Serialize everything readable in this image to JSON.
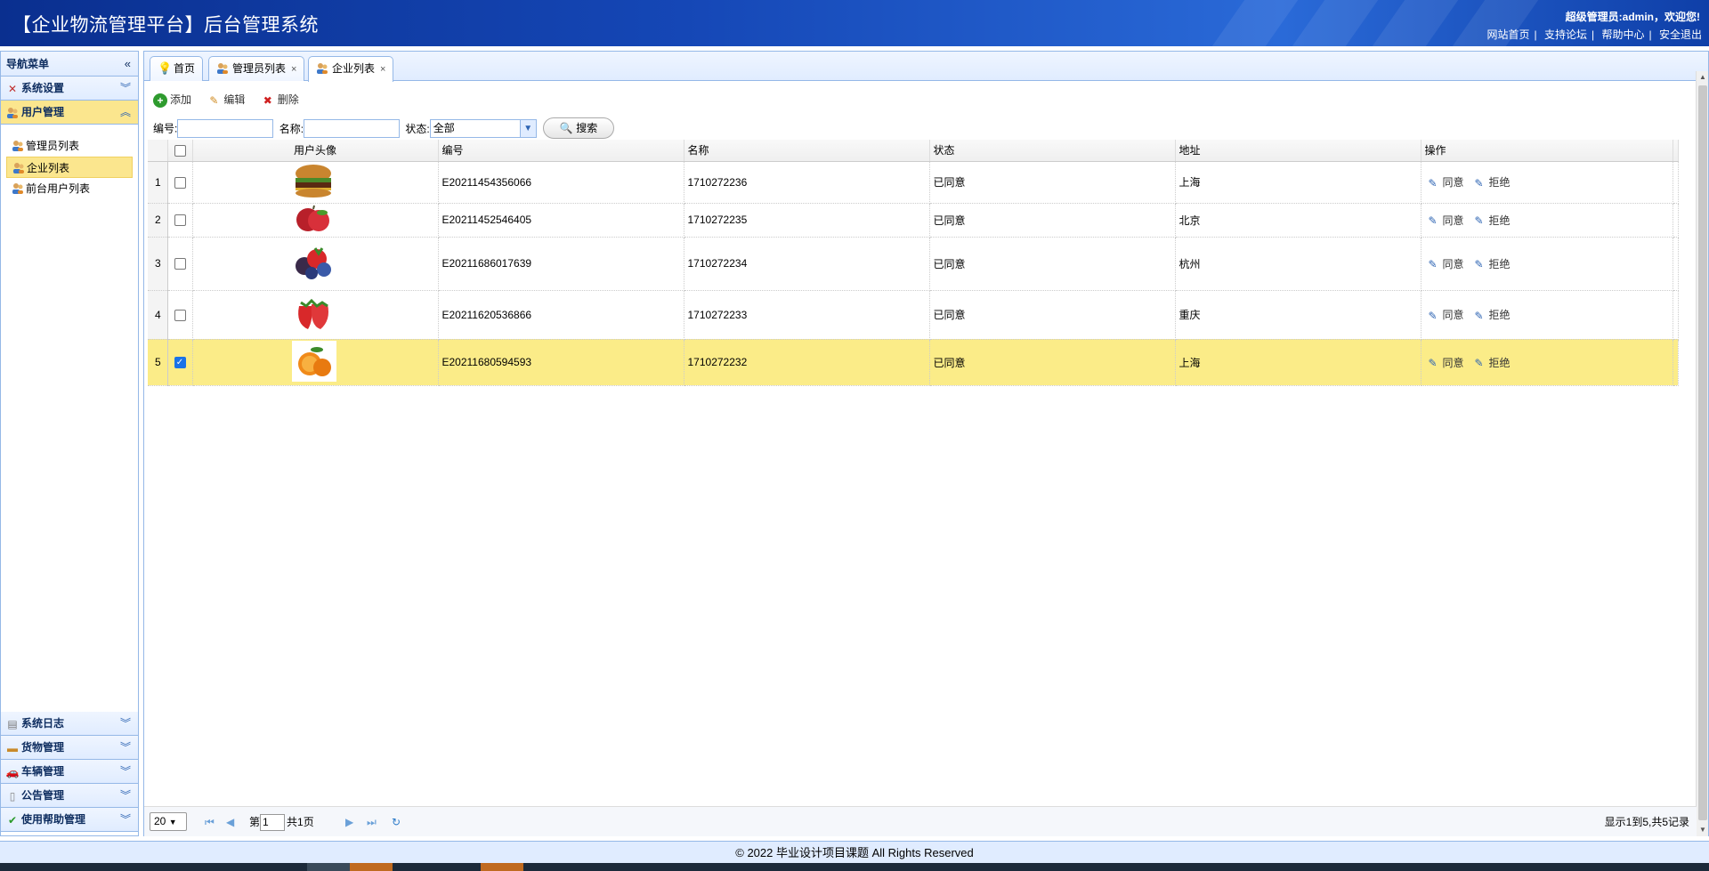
{
  "header": {
    "title": "【企业物流管理平台】后台管理系统",
    "welcome": "超级管理员:admin，欢迎您!",
    "links": [
      "网站首页",
      "支持论坛",
      "帮助中心",
      "安全退出"
    ]
  },
  "sidebar": {
    "title": "导航菜单",
    "collapse_icon": "double-chevron-left-icon",
    "sections": [
      {
        "label": "系统设置",
        "icon": "tools-icon"
      },
      {
        "label": "用户管理",
        "icon": "users-icon"
      }
    ],
    "user_items": [
      "管理员列表",
      "企业列表",
      "前台用户列表"
    ],
    "bottom_sections": [
      {
        "label": "系统日志",
        "icon": "log-icon"
      },
      {
        "label": "货物管理",
        "icon": "box-icon"
      },
      {
        "label": "车辆管理",
        "icon": "car-icon"
      },
      {
        "label": "公告管理",
        "icon": "document-icon"
      },
      {
        "label": "使用帮助管理",
        "icon": "check-icon"
      }
    ]
  },
  "tabs": [
    {
      "label": "首页",
      "icon": "bulb-icon",
      "closable": false
    },
    {
      "label": "管理员列表",
      "icon": "users-icon",
      "closable": true
    },
    {
      "label": "企业列表",
      "icon": "users-icon",
      "closable": true
    }
  ],
  "toolbar": {
    "add": "添加",
    "edit": "编辑",
    "delete": "删除"
  },
  "search": {
    "code_label": "编号:",
    "name_label": "名称:",
    "status_label": "状态:",
    "status_value": "全部",
    "button": "搜索"
  },
  "table": {
    "columns": [
      "用户头像",
      "编号",
      "名称",
      "状态",
      "地址",
      "操作"
    ],
    "rows": [
      {
        "no": "1",
        "code": "E20211454356066",
        "name": "1710272236",
        "status": "已同意",
        "address": "上海",
        "image": "burger",
        "checked": false
      },
      {
        "no": "2",
        "code": "E20211452546405",
        "name": "1710272235",
        "status": "已同意",
        "address": "北京",
        "image": "apple",
        "checked": false
      },
      {
        "no": "3",
        "code": "E20211686017639",
        "name": "1710272234",
        "status": "已同意",
        "address": "杭州",
        "image": "berries",
        "checked": false
      },
      {
        "no": "4",
        "code": "E20211620536866",
        "name": "1710272233",
        "status": "已同意",
        "address": "重庆",
        "image": "strawberry",
        "checked": false
      },
      {
        "no": "5",
        "code": "E20211680594593",
        "name": "1710272232",
        "status": "已同意",
        "address": "上海",
        "image": "orange",
        "checked": true
      }
    ],
    "actions": {
      "agree": "同意",
      "reject": "拒绝"
    }
  },
  "pager": {
    "page_size": "20",
    "page_prefix": "第",
    "page_value": "1",
    "page_suffix": "共1页",
    "info": "显示1到5,共5记录"
  },
  "footer": "© 2022 毕业设计项目课题 All Rights Reserved"
}
